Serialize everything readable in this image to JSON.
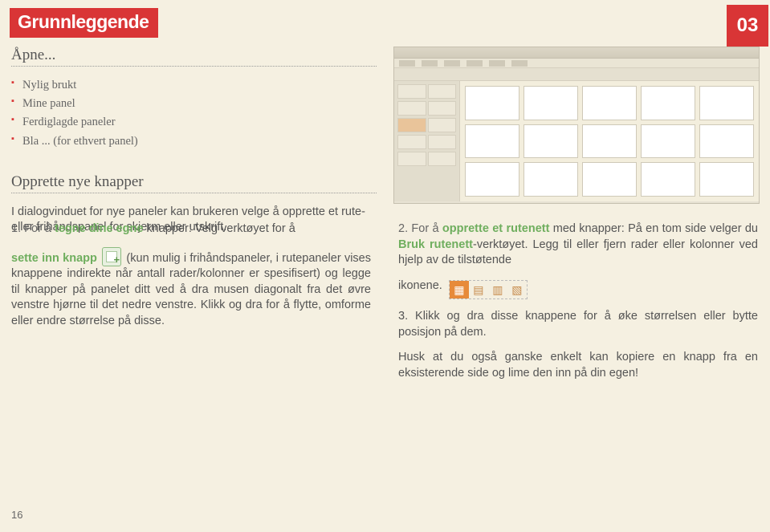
{
  "header": {
    "tab": "Grunnleggende",
    "badge": "03"
  },
  "open_section": {
    "title": "Åpne...",
    "items": [
      "Nylig brukt",
      "Mine panel",
      "Ferdiglagde paneler",
      "Bla ... (for ethvert panel)"
    ]
  },
  "create_section": {
    "title": "Opprette nye knapper",
    "intro": "I dialogvinduet for nye paneler kan brukeren velge å opprette et rute- eller frihåndspanel for skjerm eller utskrift."
  },
  "steps": {
    "s1a": "1. For å ",
    "s1b": "tegne dine egne",
    "s1c": " knapper: Velg verktøyet for å",
    "s1d": "sette inn knapp",
    "s1e": " (kun mulig i frihåndspaneler, i rutepaneler vises knappene indirekte når antall rader/kolonner er spesifisert) og legge til knapper på panelet ditt ved å dra musen diagonalt fra det øvre venstre hjørne til det nedre venstre. Klikk og dra for å flytte, omforme eller endre størrelse på disse.",
    "s2a": "2. For å ",
    "s2b": "opprette et rutenett",
    "s2c": " med knapper: På en tom side velger du ",
    "s2d": "Bruk rutenett",
    "s2e": "-verktøyet. Legg til eller fjern rader eller kolonner ved hjelp av de tilstøtende",
    "s2f": "ikonene.",
    "s3": "3. Klikk og dra disse knappene for å øke størrelsen eller bytte posisjon på dem.",
    "tip": "Husk at du også ganske enkelt kan kopiere en knapp fra en eksisterende side og lime den inn på din egen!"
  },
  "page_number": "16"
}
